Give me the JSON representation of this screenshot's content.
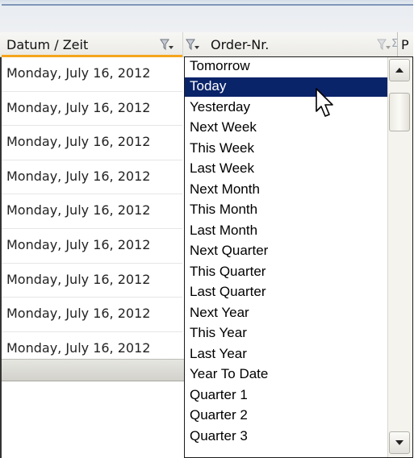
{
  "header": {
    "col1_label": "Datum / Zeit",
    "col2_label": "Order-Nr.",
    "sigma_label": "Σ",
    "col3_label": "P"
  },
  "rows": [
    "Monday, July 16, 2012",
    "Monday, July 16, 2012",
    "Monday, July 16, 2012",
    "Monday, July 16, 2012",
    "Monday, July 16, 2012",
    "Monday, July 16, 2012",
    "Monday, July 16, 2012",
    "Monday, July 16, 2012",
    "Monday, July 16, 2012"
  ],
  "dropdown": {
    "options": [
      "Tomorrow",
      "Today",
      "Yesterday",
      "Next Week",
      "This Week",
      "Last Week",
      "Next Month",
      "This Month",
      "Last Month",
      "Next Quarter",
      "This Quarter",
      "Last Quarter",
      "Next Year",
      "This Year",
      "Last Year",
      "Year To Date",
      "Quarter 1",
      "Quarter 2",
      "Quarter 3"
    ],
    "selected_index": 1
  },
  "icons": {
    "filter": "filter-funnel-icon",
    "sigma": "sigma-icon",
    "scroll_up": "arrow-up-icon",
    "scroll_down": "arrow-down-icon",
    "cursor": "mouse-pointer-icon"
  },
  "colors": {
    "selection": "#0a246a",
    "header_underline": "#f4a51c"
  }
}
